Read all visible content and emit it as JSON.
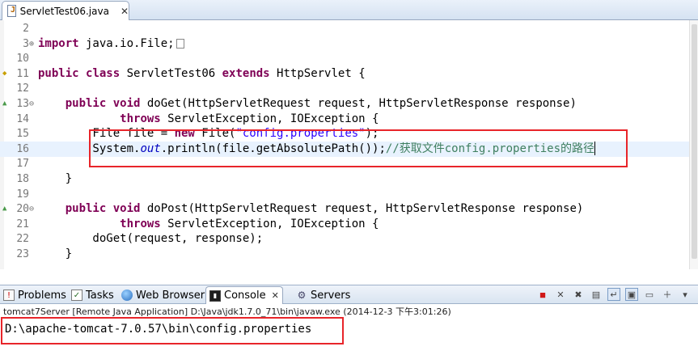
{
  "editor_tab": {
    "title": "ServletTest06.java",
    "close": "✕"
  },
  "code_lines": [
    {
      "num": "2",
      "marker": "",
      "fold": "",
      "parts": []
    },
    {
      "num": "3",
      "marker": "",
      "fold": "⊕",
      "parts": [
        {
          "t": "import",
          "c": "kw"
        },
        {
          "t": " java.io.File;",
          "c": ""
        }
      ],
      "foldbox": true
    },
    {
      "num": "10",
      "marker": "",
      "fold": "",
      "parts": []
    },
    {
      "num": "11",
      "marker": "warn",
      "fold": "",
      "parts": [
        {
          "t": "public",
          "c": "kw"
        },
        {
          "t": " ",
          "c": ""
        },
        {
          "t": "class",
          "c": "kw"
        },
        {
          "t": " ServletTest06 ",
          "c": ""
        },
        {
          "t": "extends",
          "c": "kw"
        },
        {
          "t": " HttpServlet {",
          "c": ""
        }
      ]
    },
    {
      "num": "12",
      "marker": "",
      "fold": "",
      "parts": []
    },
    {
      "num": "13",
      "marker": "override",
      "fold": "⊖",
      "parts": [
        {
          "t": "    ",
          "c": ""
        },
        {
          "t": "public",
          "c": "kw"
        },
        {
          "t": " ",
          "c": ""
        },
        {
          "t": "void",
          "c": "kw"
        },
        {
          "t": " doGet(HttpServletRequest request, HttpServletResponse response)",
          "c": ""
        }
      ]
    },
    {
      "num": "14",
      "marker": "",
      "fold": "",
      "parts": [
        {
          "t": "            ",
          "c": ""
        },
        {
          "t": "throws",
          "c": "kw"
        },
        {
          "t": " ServletException, IOException {",
          "c": ""
        }
      ]
    },
    {
      "num": "15",
      "marker": "",
      "fold": "",
      "parts": [
        {
          "t": "        File file = ",
          "c": ""
        },
        {
          "t": "new",
          "c": "kw"
        },
        {
          "t": " File(",
          "c": ""
        },
        {
          "t": "\"config.properties\"",
          "c": "str"
        },
        {
          "t": ");",
          "c": ""
        }
      ]
    },
    {
      "num": "16",
      "marker": "",
      "fold": "",
      "current": true,
      "caret": true,
      "parts": [
        {
          "t": "        System.",
          "c": ""
        },
        {
          "t": "out",
          "c": "fld"
        },
        {
          "t": ".println(file.getAbsolutePath());",
          "c": ""
        },
        {
          "t": "//获取文件config.properties的路径",
          "c": "cmt"
        }
      ]
    },
    {
      "num": "17",
      "marker": "",
      "fold": "",
      "parts": []
    },
    {
      "num": "18",
      "marker": "",
      "fold": "",
      "parts": [
        {
          "t": "    }",
          "c": ""
        }
      ]
    },
    {
      "num": "19",
      "marker": "",
      "fold": "",
      "parts": []
    },
    {
      "num": "20",
      "marker": "override",
      "fold": "⊖",
      "parts": [
        {
          "t": "    ",
          "c": ""
        },
        {
          "t": "public",
          "c": "kw"
        },
        {
          "t": " ",
          "c": ""
        },
        {
          "t": "void",
          "c": "kw"
        },
        {
          "t": " doPost(HttpServletRequest request, HttpServletResponse response)",
          "c": ""
        }
      ]
    },
    {
      "num": "21",
      "marker": "",
      "fold": "",
      "parts": [
        {
          "t": "            ",
          "c": ""
        },
        {
          "t": "throws",
          "c": "kw"
        },
        {
          "t": " ServletException, IOException {",
          "c": ""
        }
      ]
    },
    {
      "num": "22",
      "marker": "",
      "fold": "",
      "parts": [
        {
          "t": "        doGet(request, response);",
          "c": ""
        }
      ]
    },
    {
      "num": "23",
      "marker": "",
      "fold": "",
      "parts": [
        {
          "t": "    }",
          "c": ""
        }
      ]
    }
  ],
  "views": {
    "problems": "Problems",
    "tasks": "Tasks",
    "web_browser": "Web Browser",
    "console": "Console",
    "console_close": "✕",
    "servers": "Servers"
  },
  "toolbar_icons": [
    "terminate-icon",
    "remove-launch-icon",
    "remove-all-icon",
    "scroll-lock-icon",
    "word-wrap-icon",
    "pin-console-icon",
    "display-console-icon",
    "new-console-icon",
    "view-menu-icon"
  ],
  "console": {
    "header": "tomcat7Server [Remote Java Application] D:\\Java\\jdk1.7.0_71\\bin\\javaw.exe (2014-12-3 下午3:01:26)",
    "output": "D:\\apache-tomcat-7.0.57\\bin\\config.properties"
  },
  "colors": {
    "keyword": "#7f0055",
    "string": "#2a00ff",
    "comment": "#3f7f5f",
    "field": "#0000c0",
    "highlight": "#e8252a"
  }
}
